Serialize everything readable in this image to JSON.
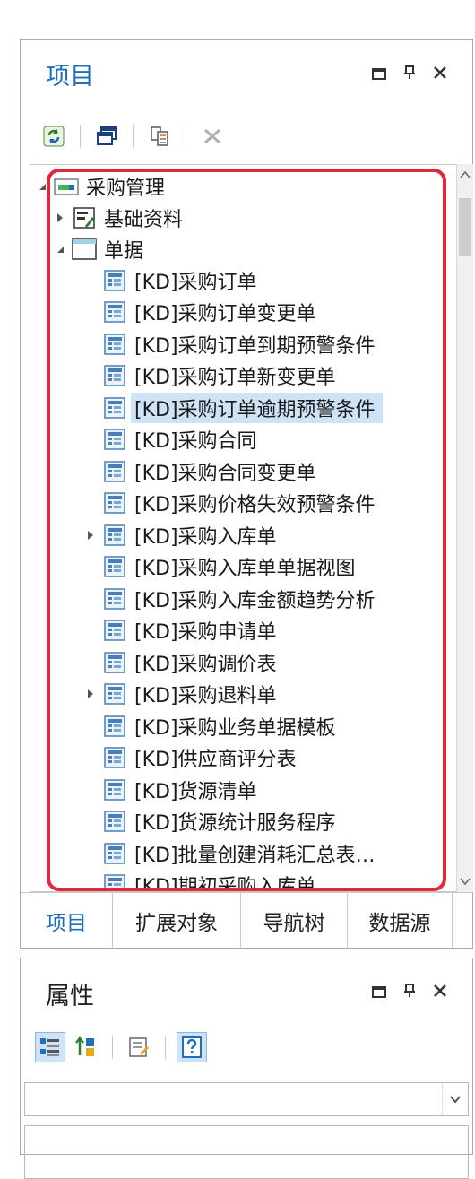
{
  "project_panel": {
    "title": "项目",
    "tree": {
      "root": "采购管理",
      "basic": "基础资料",
      "docs": "单据",
      "items": [
        "[KD]采购订单",
        "[KD]采购订单变更单",
        "[KD]采购订单到期预警条件",
        "[KD]采购订单新变更单",
        "[KD]采购订单逾期预警条件",
        "[KD]采购合同",
        "[KD]采购合同变更单",
        "[KD]采购价格失效预警条件",
        "[KD]采购入库单",
        "[KD]采购入库单单据视图",
        "[KD]采购入库金额趋势分析",
        "[KD]采购申请单",
        "[KD]采购调价表",
        "[KD]采购退料单",
        "[KD]采购业务单据模板",
        "[KD]供应商评分表",
        "[KD]货源清单",
        "[KD]货源统计服务程序",
        "[KD]批量创建消耗汇总表…",
        "[KD]期初采购入库单"
      ],
      "selected_index": 4,
      "expandable_indices": [
        8,
        13
      ]
    },
    "tabs": [
      "项目",
      "扩展对象",
      "导航树",
      "数据源"
    ],
    "active_tab": 0
  },
  "property_panel": {
    "title": "属性"
  },
  "colors": {
    "accent": "#1e6fc0",
    "selection": "#cfe3f7",
    "highlight_border": "#e3263b"
  },
  "icons": {
    "refresh": "refresh-icon",
    "windows": "windows-icon",
    "copy": "copy-icon",
    "delete": "delete-icon",
    "form": "form-icon",
    "categorized": "categorized-icon",
    "sort_az": "sort-az-icon",
    "property_pages": "property-pages-icon",
    "help": "help-icon"
  }
}
